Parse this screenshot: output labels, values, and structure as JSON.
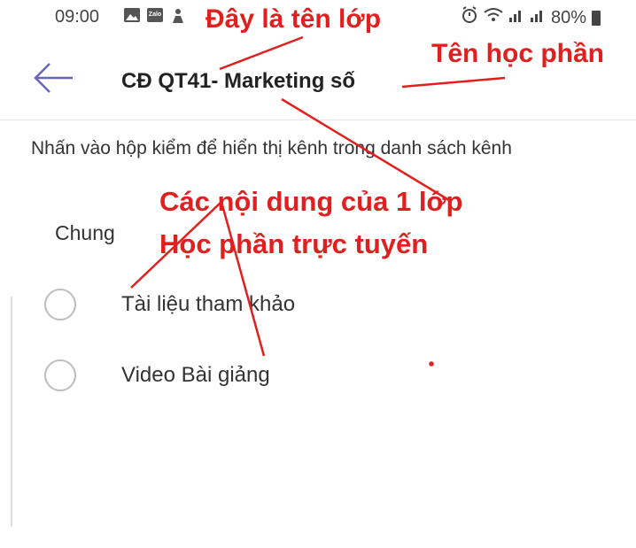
{
  "status_bar": {
    "time": "09:00",
    "zalo_icon_text": "Zalo",
    "battery_text": "80%",
    "icons_left": [
      "gallery-icon",
      "zalo-icon",
      "person-icon"
    ],
    "icons_right": [
      "alarm-icon",
      "wifi-icon",
      "signal-icon",
      "signal-icon",
      "battery-icon"
    ]
  },
  "header": {
    "title": "CĐ QT41- Marketing số",
    "back_icon": "arrow-left-icon"
  },
  "main": {
    "instruction": "Nhấn vào hộp kiểm để hiển thị kênh trong danh sách kênh",
    "section_title": "Chung",
    "channels": [
      {
        "label": "Tài liệu tham khảo",
        "checked": false
      },
      {
        "label": "Video Bài giảng",
        "checked": false
      }
    ]
  },
  "annotations": {
    "class_name": "Đây là tên lớp",
    "course_name": "Tên học phần",
    "content_line1": "Các nội dung của 1 lớp",
    "content_line2": "Học phần trực tuyến"
  },
  "colors": {
    "annotation": "#e21f1f",
    "back_arrow": "#6a64b5",
    "radio_border": "#bdbdbd"
  }
}
